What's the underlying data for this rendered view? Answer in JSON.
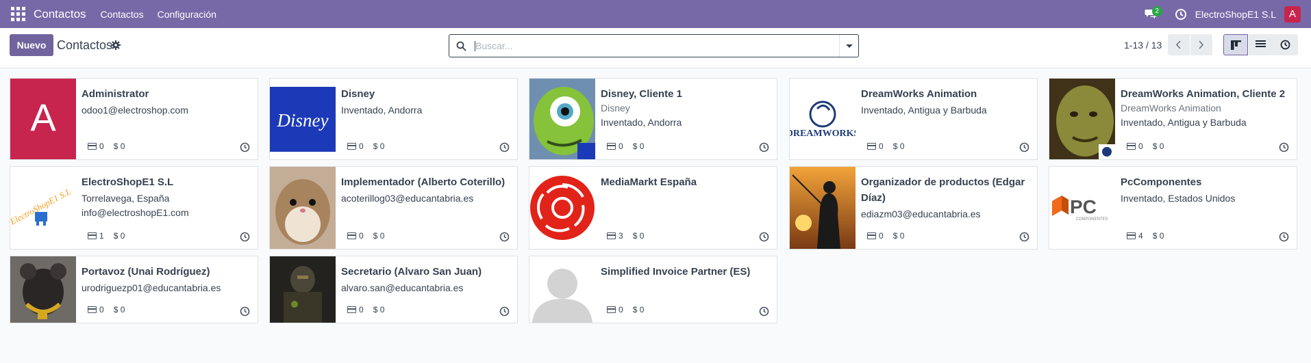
{
  "navbar": {
    "brand": "Contactos",
    "menu": [
      "Contactos",
      "Configuración"
    ],
    "chat_count": "2",
    "company": "ElectroShopE1 S.L",
    "user_initial": "A",
    "icons": [
      "apps-grid-icon",
      "chat-icon",
      "clock-icon"
    ]
  },
  "control": {
    "new_label": "Nuevo",
    "title": "Contactos",
    "search_placeholder": "Buscar...",
    "pager": "1-13 / 13"
  },
  "colors": {
    "navbar": "#7768a7",
    "primary": "#71639e",
    "avatar": "#c7254e"
  },
  "cards": [
    {
      "name": "Administrator",
      "lines": [
        "odoo1@electroshop.com"
      ],
      "sub": "",
      "count": "0",
      "amount": "$ 0",
      "image": "letter-avatar-A"
    },
    {
      "name": "Disney",
      "lines": [
        "Inventado, Andorra"
      ],
      "sub": "",
      "count": "0",
      "amount": "$ 0",
      "image": "disney-logo"
    },
    {
      "name": "Disney, Cliente 1",
      "sub": "Disney",
      "lines": [
        "Inventado, Andorra"
      ],
      "count": "0",
      "amount": "$ 0",
      "image": "monster-photo"
    },
    {
      "name": "DreamWorks Animation",
      "lines": [
        "Inventado, Antigua y Barbuda"
      ],
      "sub": "",
      "count": "0",
      "amount": "$ 0",
      "image": "dreamworks-logo"
    },
    {
      "name": "DreamWorks Animation, Cliente 2",
      "sub": "DreamWorks Animation",
      "lines": [
        "Inventado, Antigua y Barbuda"
      ],
      "count": "0",
      "amount": "$ 0",
      "image": "ogre-photo"
    },
    {
      "name": "ElectroShopE1 S.L",
      "lines": [
        "Torrelavega, España",
        "info@electroshopE1.com"
      ],
      "sub": "",
      "count": "1",
      "amount": "$ 0",
      "image": "electroshop-logo"
    },
    {
      "name": "Implementador (Alberto Coterillo)",
      "lines": [
        "acoterillog03@educantabria.es"
      ],
      "sub": "",
      "count": "0",
      "amount": "$ 0",
      "image": "hamster-photo"
    },
    {
      "name": "MediaMarkt España",
      "lines": [],
      "sub": "",
      "count": "3",
      "amount": "$ 0",
      "image": "mediamarkt-logo"
    },
    {
      "name": "Organizador de productos (Edgar Díaz)",
      "lines": [
        "ediazm03@educantabria.es"
      ],
      "sub": "",
      "count": "0",
      "amount": "$ 0",
      "image": "fishing-photo"
    },
    {
      "name": "PcComponentes",
      "lines": [
        "Inventado, Estados Unidos"
      ],
      "sub": "",
      "count": "4",
      "amount": "$ 0",
      "image": "pccomponentes-logo"
    },
    {
      "name": "Portavoz (Unai Rodríguez)",
      "lines": [
        "urodriguezp01@educantabria.es"
      ],
      "sub": "",
      "count": "0",
      "amount": "$ 0",
      "image": "rat-photo"
    },
    {
      "name": "Secretario (Alvaro San Juan)",
      "lines": [
        "alvaro.san@educantabria.es"
      ],
      "sub": "",
      "count": "0",
      "amount": "$ 0",
      "image": "soldier-photo"
    },
    {
      "name": "Simplified Invoice Partner (ES)",
      "lines": [],
      "sub": "",
      "count": "0",
      "amount": "$ 0",
      "image": "placeholder-avatar"
    }
  ]
}
